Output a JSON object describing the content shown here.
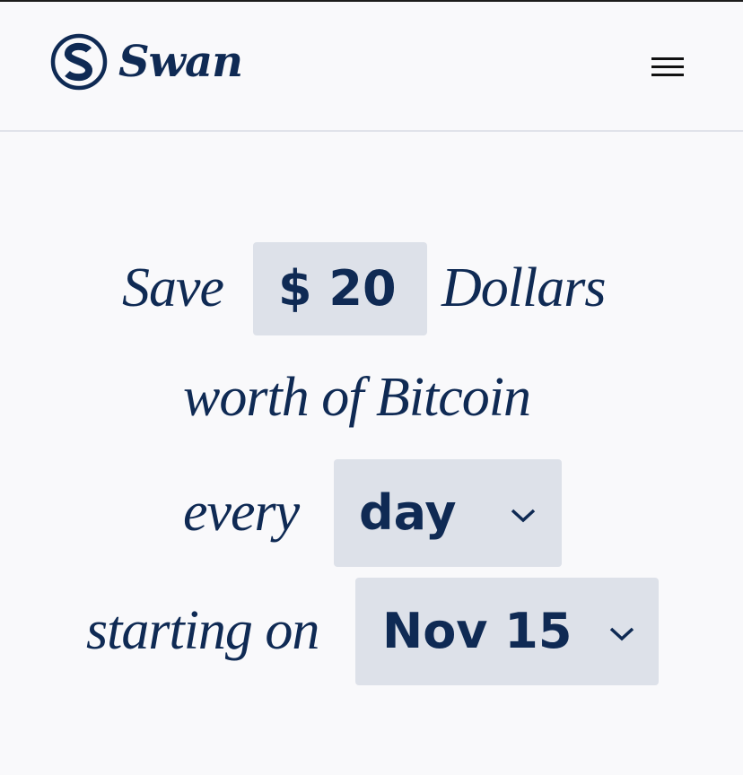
{
  "header": {
    "brand_name": "Swan",
    "logo_icon": "swan-s-logo-icon",
    "menu_icon": "hamburger-menu-icon"
  },
  "form": {
    "save_label": "Save",
    "amount_value": "$ 20",
    "currency_label": "Dollars",
    "asset_label": "worth of Bitcoin",
    "frequency_prefix": "every",
    "frequency_value": "day",
    "start_prefix": "starting on",
    "start_date_value": "Nov 15"
  },
  "colors": {
    "brand": "#0f2a54",
    "pill_background": "#dde1e9",
    "page_background": "#f9f9fb"
  }
}
